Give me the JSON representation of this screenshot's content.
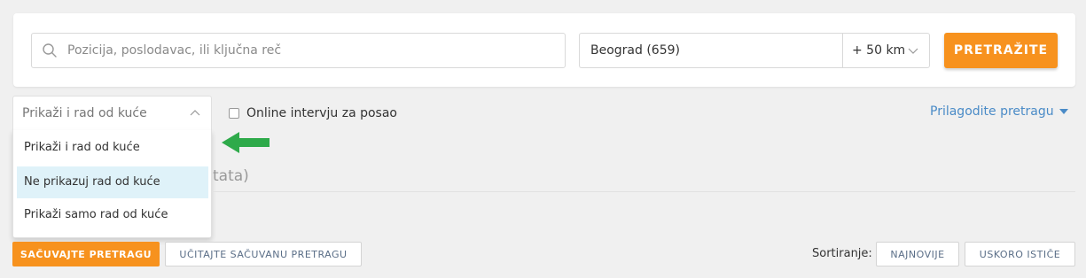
{
  "search": {
    "keyword_placeholder": "Pozicija, poslodavac, ili ključna reč",
    "location_value": "Beograd (659)",
    "radius_value": "+ 50 km",
    "search_button_label": "PRETRAŽITE"
  },
  "filters": {
    "remote_selected": "Prikaži i rad od kuće",
    "remote_options": [
      "Prikaži i rad od kuće",
      "Ne prikazuj rad od kuće",
      "Prikaži samo rad od kuće"
    ],
    "online_interview_label": "Online intervju za posao",
    "customize_label": "Prilagodite pretragu"
  },
  "results": {
    "count_fragment": "tata)"
  },
  "actions": {
    "save_search_label": "SAČUVAJTE PRETRAGU",
    "load_search_label": "UČITAJTE SAČUVANU PRETRAGU",
    "sort_label": "Sortiranje:",
    "sort_newest_label": "NAJNOVIJE",
    "sort_expiring_label": "USKORO ISTIČE"
  },
  "colors": {
    "accent_orange": "#f7921e",
    "link_blue": "#4a8bc7",
    "selected_option_bg": "#dff2f9",
    "annotation_arrow_green": "#2eaa4a"
  }
}
